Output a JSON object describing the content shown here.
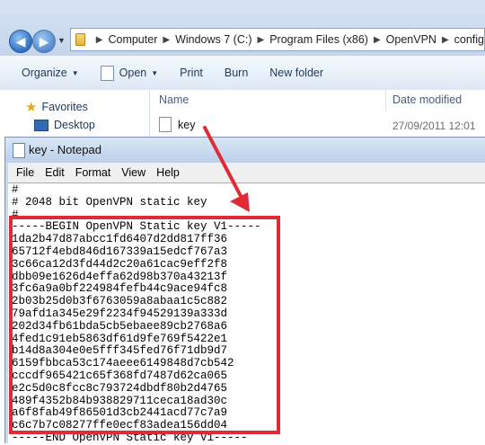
{
  "explorer": {
    "breadcrumb": [
      "Computer",
      "Windows 7 (C:)",
      "Program Files (x86)",
      "OpenVPN",
      "config"
    ],
    "toolbar": {
      "organize": "Organize",
      "open": "Open",
      "print": "Print",
      "burn": "Burn",
      "new_folder": "New folder"
    },
    "nav": {
      "favorites": "Favorites",
      "desktop": "Desktop"
    },
    "columns": {
      "name": "Name",
      "date_modified": "Date modified"
    },
    "files": [
      {
        "name": "key",
        "date": "27/09/2011 12:01"
      }
    ]
  },
  "notepad": {
    "title": "key - Notepad",
    "menu": [
      "File",
      "Edit",
      "Format",
      "View",
      "Help"
    ],
    "lines": [
      "#",
      "# 2048 bit OpenVPN static key",
      "#",
      "-----BEGIN OpenVPN Static key V1-----",
      "1da2b47d87abcc1fd6407d2dd817ff36",
      "65712f4ebd846d167339a15edcf767a3",
      "3c66ca12d3fd44d2c20a61cac9eff2f8",
      "dbb09e1626d4effa62d98b370a43213f",
      "3fc6a9a0bf224984fefb44c9ace94fc8",
      "2b03b25d0b3f6763059a8abaa1c5c882",
      "79afd1a345e29f2234f94529139a333d",
      "202d34fb61bda5cb5ebaee89cb2768a6",
      "4fed1c91eb5863df61d9fe769f5422e1",
      "b14d8a304e0e5fff345fed76f71db9d7",
      "6159fbbca53c174aeee6149848d7cb542",
      "cccdf965421c65f368fd7487d62ca065",
      "e2c5d0c8fcc8c793724dbdf80b2d4765",
      "489f4352b84b938829711ceca18ad30c",
      "a6f8fab49f86501d3cb2441acd77c7a9",
      "c6c7b7c08277ffe0ecf83adea156dd04",
      "-----END OpenVPN Static key V1-----"
    ]
  },
  "colors": {
    "highlight": "#e02a35",
    "titlebar": "#c9d9ee"
  }
}
